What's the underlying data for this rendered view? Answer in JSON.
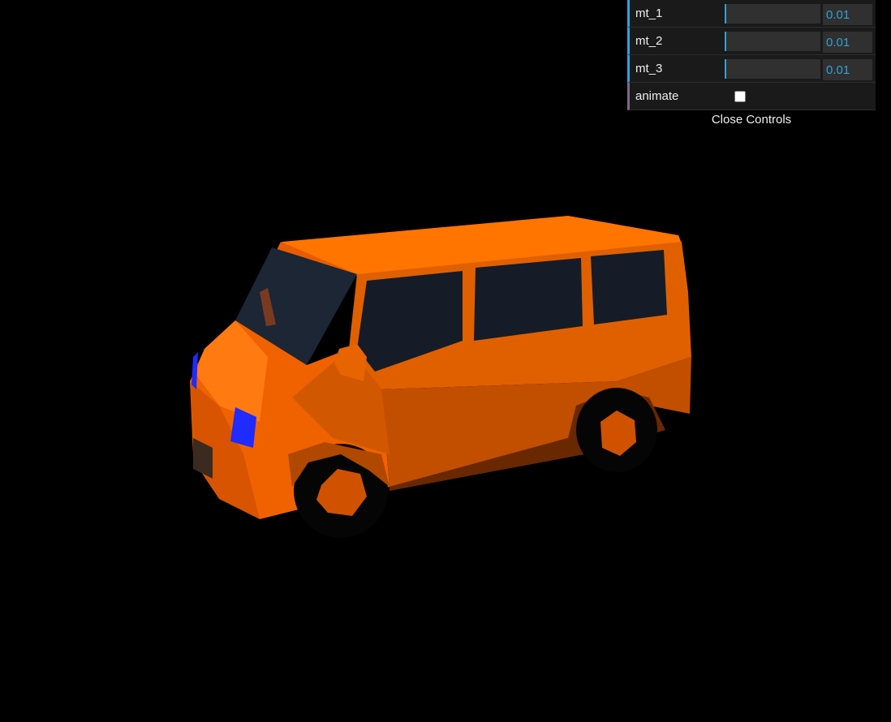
{
  "controls": {
    "sliders": [
      {
        "label": "mt_1",
        "value": "0.01",
        "fill_fraction": 0.0
      },
      {
        "label": "mt_2",
        "value": "0.01",
        "fill_fraction": 0.0
      },
      {
        "label": "mt_3",
        "value": "0.01",
        "fill_fraction": 0.0
      }
    ],
    "animate": {
      "label": "animate",
      "checked": false
    },
    "close_label": "Close Controls"
  },
  "scene": {
    "background_color": "#000000",
    "van_color": "#ff6a00",
    "window_color": "#1a2230",
    "headlight_color": "#1f2bff"
  }
}
